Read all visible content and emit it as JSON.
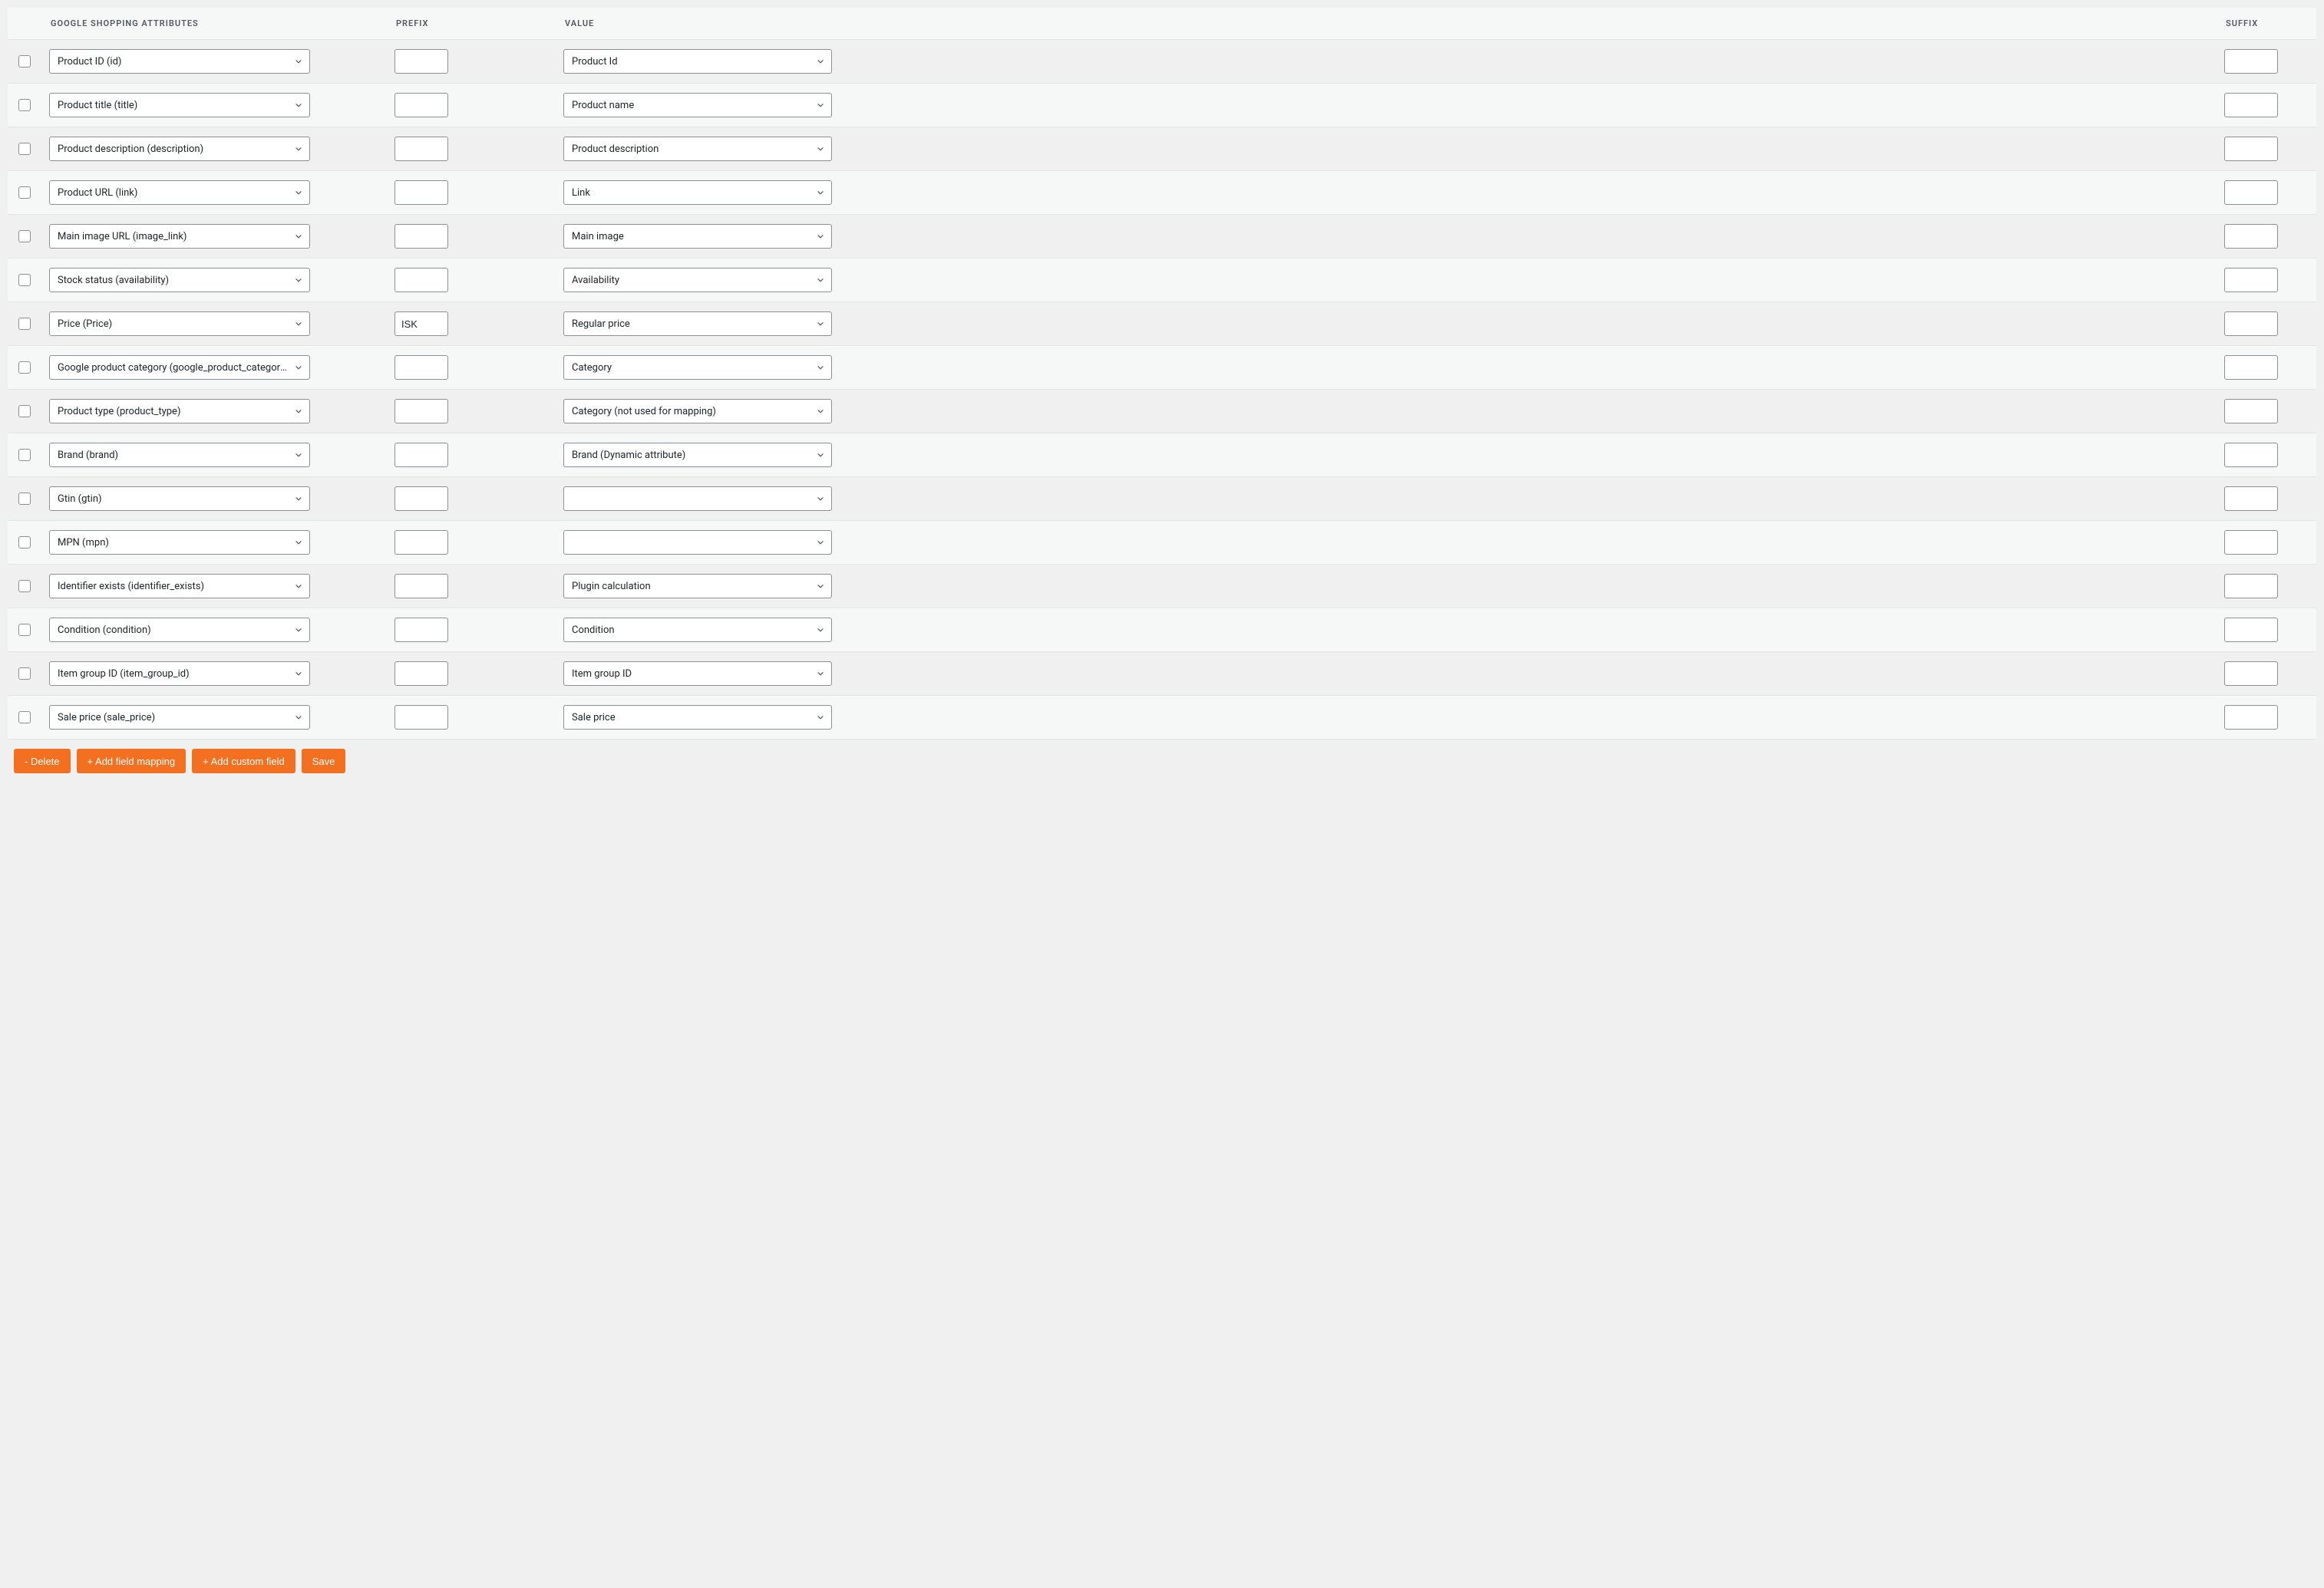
{
  "columns": {
    "attr": "GOOGLE SHOPPING ATTRIBUTES",
    "prefix": "PREFIX",
    "value": "VALUE",
    "suffix": "SUFFIX"
  },
  "rows": [
    {
      "attr": "Product ID (id)",
      "prefix": "",
      "value": "Product Id",
      "suffix": ""
    },
    {
      "attr": "Product title (title)",
      "prefix": "",
      "value": "Product name",
      "suffix": ""
    },
    {
      "attr": "Product description (description)",
      "prefix": "",
      "value": "Product description",
      "suffix": ""
    },
    {
      "attr": "Product URL (link)",
      "prefix": "",
      "value": "Link",
      "suffix": ""
    },
    {
      "attr": "Main image URL (image_link)",
      "prefix": "",
      "value": "Main image",
      "suffix": ""
    },
    {
      "attr": "Stock status (availability)",
      "prefix": "",
      "value": "Availability",
      "suffix": ""
    },
    {
      "attr": "Price (Price)",
      "prefix": "ISK",
      "value": "Regular price",
      "suffix": ""
    },
    {
      "attr": "Google product category (google_product_category)",
      "prefix": "",
      "value": "Category",
      "suffix": ""
    },
    {
      "attr": "Product type (product_type)",
      "prefix": "",
      "value": "Category (not used for mapping)",
      "suffix": ""
    },
    {
      "attr": "Brand (brand)",
      "prefix": "",
      "value": "Brand (Dynamic attribute)",
      "suffix": ""
    },
    {
      "attr": "Gtin (gtin)",
      "prefix": "",
      "value": "",
      "suffix": ""
    },
    {
      "attr": "MPN (mpn)",
      "prefix": "",
      "value": "",
      "suffix": ""
    },
    {
      "attr": "Identifier exists (identifier_exists)",
      "prefix": "",
      "value": "Plugin calculation",
      "suffix": ""
    },
    {
      "attr": "Condition (condition)",
      "prefix": "",
      "value": "Condition",
      "suffix": ""
    },
    {
      "attr": "Item group ID (item_group_id)",
      "prefix": "",
      "value": "Item group ID",
      "suffix": ""
    },
    {
      "attr": "Sale price (sale_price)",
      "prefix": "",
      "value": "Sale price",
      "suffix": ""
    }
  ],
  "actions": {
    "delete": "- Delete",
    "add_mapping": "+ Add field mapping",
    "add_custom": "+ Add custom field",
    "save": "Save"
  }
}
